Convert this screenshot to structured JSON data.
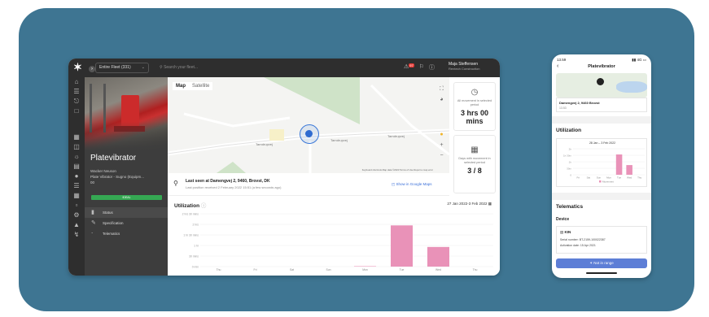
{
  "desktop": {
    "fleet_select": "Entire Fleet (331)",
    "search_placeholder": "Search your fleet...",
    "notif_count": "97",
    "user_name": "Maja Steffensen",
    "user_company": "Rentech Construction",
    "machine": {
      "title": "Platevibrator",
      "subtitle": "Wacker Neuson",
      "subtitle2": "Plate Vibrator - Sugno (Equipm...",
      "code": "00",
      "status": "IDEAL"
    },
    "nav": [
      {
        "label": "Status",
        "icon": "bar-chart-icon"
      },
      {
        "label": "Specification",
        "icon": "edit-icon"
      },
      {
        "label": "Telematics",
        "icon": "signal-icon"
      }
    ],
    "map": {
      "tab_map": "Map",
      "tab_satellite": "Satellite",
      "road_label": "Tarndrupvej",
      "attribution": "Keyboard shortcuts  Map data ©2023  Terms of Use  Report a map error",
      "location_title": "Last seen at Damengvej 2, 9460, Brovst, DK",
      "location_sub": "Last position received 2 February 2022 15:51 (a few seconds ago)",
      "google_link": "Show in Google Maps"
    },
    "cards": [
      {
        "icon": "clock-icon",
        "label": "All movement in selected period",
        "value": "3 hrs 00 mins"
      },
      {
        "icon": "calendar-icon",
        "label": "Days with movement in selected period",
        "value": "3 / 8"
      }
    ],
    "utilization": {
      "title": "Utilization",
      "range": "27 Jan 2022-3 Feb 2022"
    }
  },
  "phone": {
    "time": "13.59",
    "signal": "4G",
    "title": "Platevibrator",
    "address": "Damengvej 2, 9460 Brovst",
    "address_sub": "13.53",
    "utilization_title": "Utilization",
    "chart_range": "28 Jan – 3 Feb 2022",
    "telematics_title": "Telematics",
    "device_label": "Device",
    "device_name": "KIN",
    "serial": "Serial number:  BT-2159-100022387",
    "activation": "Activation date:  15 Apr 2021",
    "button": "Not in range"
  },
  "chart_data": [
    {
      "type": "bar",
      "title": "Utilization",
      "categories": [
        "Thu",
        "Fri",
        "Sat",
        "Sun",
        "Mon",
        "Tue",
        "Wed",
        "Thu"
      ],
      "values": [
        0,
        0,
        0,
        0,
        0.02,
        1.95,
        0.93,
        0
      ],
      "ylim": [
        0,
        2.5
      ],
      "y_ticks": [
        "0 min",
        "30 mins",
        "1 hr",
        "1 hr 30 mins",
        "2 hrs",
        "2 hrs 30 mins"
      ],
      "color": "#e992b8"
    },
    {
      "type": "bar",
      "title": "28 Jan – 3 Feb 2022",
      "categories": [
        "Fri",
        "Sat",
        "Sun",
        "Mon",
        "Tue",
        "Wed",
        "Thu"
      ],
      "values": [
        0,
        0,
        0,
        0,
        1.95,
        0.93,
        0
      ],
      "ylim": [
        0,
        2.5
      ],
      "y_ticks": [
        "0",
        "30m",
        "1h",
        "1h 30m",
        "2h"
      ],
      "legend": "Movement",
      "color": "#e992b8"
    }
  ]
}
